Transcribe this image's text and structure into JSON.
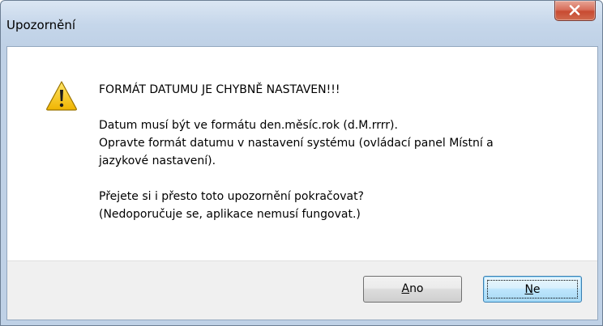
{
  "window": {
    "title": "Upozornění"
  },
  "message": {
    "heading": "FORMÁT DATUMU JE CHYBNĚ NASTAVEN!!!",
    "line1": "Datum musí být ve formátu den.měsíc.rok (d.M.rrrr).",
    "line2": "Opravte formát datumu v nastavení systému (ovládací panel Místní a",
    "line3": "jazykové nastavení).",
    "line4": "Přejete si i přesto toto upozornění pokračovat?",
    "line5": "(Nedoporučuje se, aplikace nemusí fungovat.)"
  },
  "buttons": {
    "yes": {
      "accel": "A",
      "rest": "no"
    },
    "no": {
      "accel": "N",
      "rest": "e"
    }
  },
  "icons": {
    "close": "close-icon",
    "warning": "warning-icon"
  },
  "colors": {
    "close_button": "#c84b32",
    "warning_fill": "#f2c200",
    "default_button_border": "#3c7fb1"
  }
}
